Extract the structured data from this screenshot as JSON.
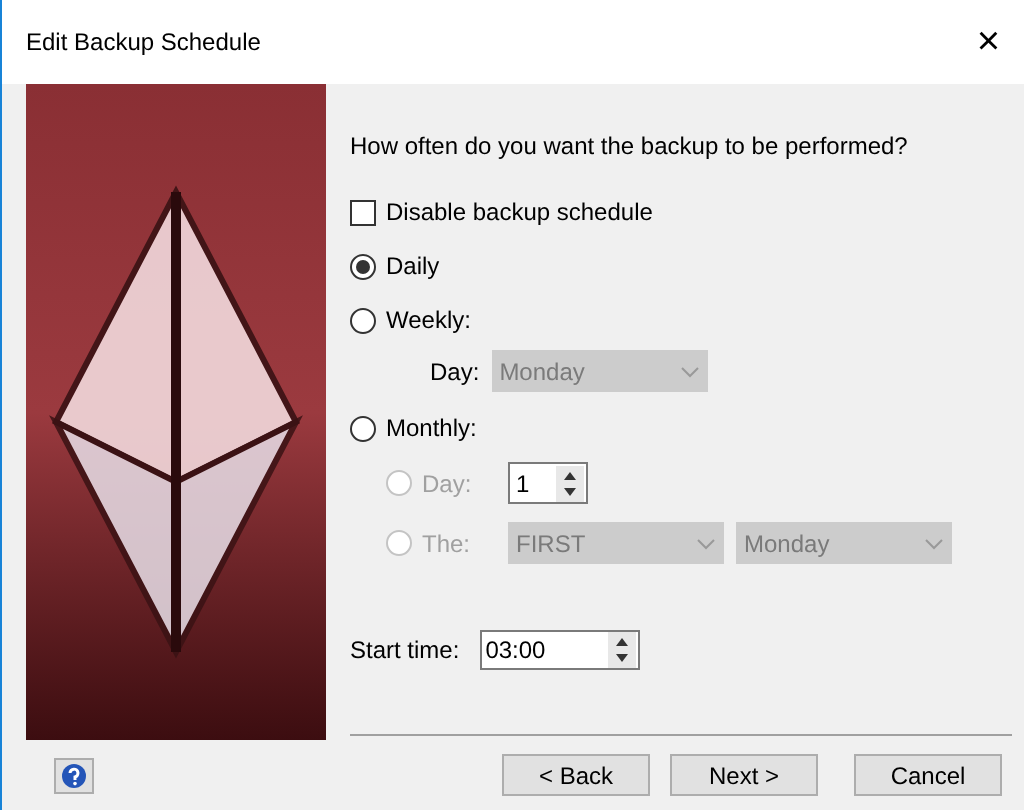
{
  "window": {
    "title": "Edit Backup Schedule",
    "close": "×"
  },
  "question": "How often do you want the backup to be performed?",
  "disable_checkbox": {
    "label": "Disable backup schedule",
    "checked": false
  },
  "frequency": [
    {
      "kind": "plain",
      "label": "Daily",
      "selected": true
    },
    {
      "kind": "weekly",
      "label": "Weekly:",
      "selected": false,
      "day_label": "Day:",
      "day_value": "Monday",
      "disabled": true
    },
    {
      "kind": "monthly",
      "label": "Monthly:",
      "selected": false,
      "options": [
        {
          "kind": "day",
          "label": "Day:",
          "value": "1",
          "selected": false,
          "disabled": true
        },
        {
          "kind": "the",
          "label": "The:",
          "value": "FIRST",
          "value_2": "Monday",
          "selected": false,
          "disabled": true
        }
      ]
    }
  ],
  "start_time": {
    "label": "Start time:",
    "value": "03:00"
  },
  "buttons": [
    {
      "label": "< Back"
    },
    {
      "label": "Next >"
    },
    {
      "label": "Cancel"
    }
  ]
}
